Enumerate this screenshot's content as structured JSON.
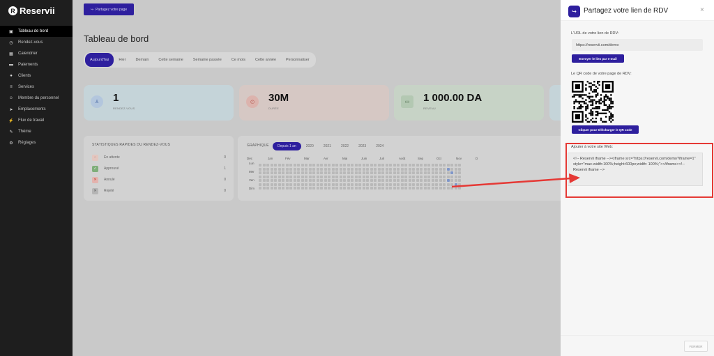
{
  "app": {
    "name": "Reservii"
  },
  "sidebar": {
    "items": [
      {
        "label": "Tableau de bord",
        "icon": "dashboard-icon",
        "active": true
      },
      {
        "label": "Rendez-vous",
        "icon": "clock-icon"
      },
      {
        "label": "Calendrier",
        "icon": "calendar-icon"
      },
      {
        "label": "Paiements",
        "icon": "payment-icon"
      },
      {
        "label": "Clients",
        "icon": "users-icon"
      },
      {
        "label": "Services",
        "icon": "list-icon"
      },
      {
        "label": "Membre du personnel",
        "icon": "staff-icon"
      },
      {
        "label": "Emplacements",
        "icon": "location-icon"
      },
      {
        "label": "Flux de travail",
        "icon": "workflow-icon"
      },
      {
        "label": "Thème",
        "icon": "brush-icon"
      },
      {
        "label": "Réglages",
        "icon": "gear-icon"
      }
    ]
  },
  "header": {
    "share_label": "Partagez votre page"
  },
  "main": {
    "title": "Tableau de bord",
    "tabs": [
      "Aujourd'hui",
      "Hier",
      "Demain",
      "Cette semaine",
      "Semaine passée",
      "Ce mois",
      "Cette année",
      "Personnaliser"
    ],
    "active_tab": "Aujourd'hui",
    "cards": [
      {
        "value": "1",
        "label": "RENDEZ-VOUS",
        "color": "#c5d4d9",
        "icon": "user-icon"
      },
      {
        "value": "30M",
        "label": "DURÉE",
        "color": "#d6c8c4",
        "icon": "timer-icon"
      },
      {
        "value": "1 000.00 DA",
        "label": "REVENU",
        "color": "#c7d3c6",
        "icon": "wallet-icon"
      }
    ]
  },
  "stats": {
    "title": "STATISTIQUES RAPIDES DU RENDEZ-VOUS",
    "rows": [
      {
        "label": "En attente",
        "value": "0",
        "color": "#d9a79a",
        "icon": "pending-icon"
      },
      {
        "label": "Approuvé",
        "value": "1",
        "color": "#8fb58a",
        "icon": "check-icon"
      },
      {
        "label": "Annulé",
        "value": "0",
        "color": "#d98a84",
        "icon": "cancel-icon"
      },
      {
        "label": "Rejeté",
        "value": "0",
        "color": "#9a9a9a",
        "icon": "reject-icon"
      }
    ]
  },
  "graph": {
    "title": "GRAPHIQUE",
    "year_tabs": [
      "Depuis 1 an",
      "2020",
      "2021",
      "2022",
      "2023",
      "2024"
    ],
    "active_year_tab": "Depuis 1 an",
    "months": [
      "Déc",
      "Jan",
      "Fév",
      "Mar",
      "Avr",
      "Mai",
      "Juin",
      "Juil",
      "Août",
      "Sep",
      "Oct",
      "Nov",
      "D"
    ],
    "days": [
      "Lun",
      "Mer",
      "Ven",
      "Dim"
    ]
  },
  "dialog": {
    "title": "Partagez votre lien de RDV",
    "close": "×",
    "url_label": "L'URL de votre lien de RDV:",
    "url_value": "https://reservii.com/demo",
    "email_button": "Envoyer le lien par e-mail",
    "qr_label": "Le QR code de votre page de RDV:",
    "qr_button": "Cliquer pour télécharger le QR code",
    "embed_label": "Ajouter à votre site Web:",
    "embed_code": "<!-- Reservii iframe --><iframe src=\"https://reservii.com/demo?iframe=1\" style=\"max-width:100%;height:600px;width: 100%;\"></iframe><!-- Reservii iframe -->",
    "close_button": "FERMER",
    "highlight_color": "#e53935"
  }
}
